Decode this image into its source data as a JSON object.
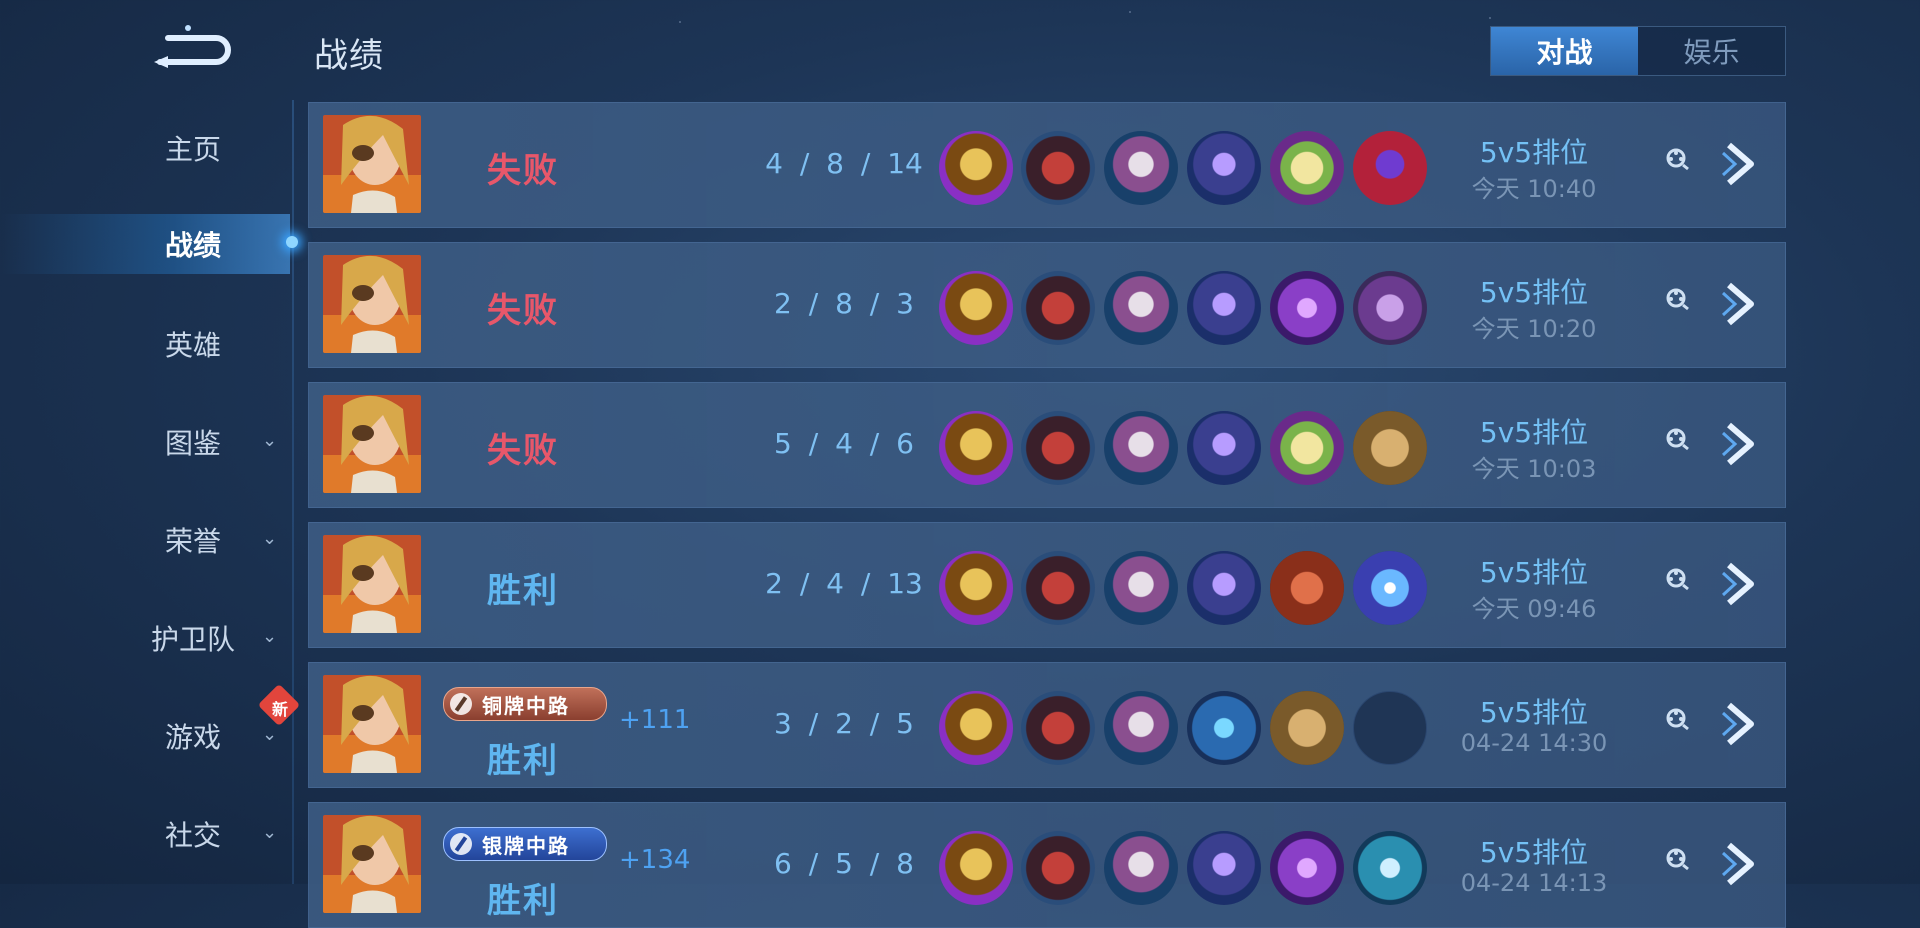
{
  "header": {
    "title": "战绩",
    "mode_tabs": [
      {
        "label": "对战",
        "active": true
      },
      {
        "label": "娱乐",
        "active": false
      }
    ]
  },
  "sidebar": {
    "items": [
      {
        "label": "主页",
        "has_chevron": false,
        "active": false
      },
      {
        "label": "战绩",
        "has_chevron": false,
        "active": true
      },
      {
        "label": "英雄",
        "has_chevron": false,
        "active": false
      },
      {
        "label": "图鉴",
        "has_chevron": true,
        "active": false
      },
      {
        "label": "荣誉",
        "has_chevron": true,
        "active": false
      },
      {
        "label": "护卫队",
        "has_chevron": true,
        "active": false
      },
      {
        "label": "游戏",
        "has_chevron": true,
        "active": false
      },
      {
        "label": "社交",
        "has_chevron": true,
        "active": false
      }
    ],
    "new_badge": "新"
  },
  "matches": [
    {
      "result": "失败",
      "outcome": "lose",
      "rank_badge": "",
      "rank_tier": "",
      "score_delta": "",
      "kda": "4 / 8 / 14",
      "mode": "5v5排位",
      "time": "今天 10:40",
      "items": [
        "gold-helmet-icon",
        "red-armor-icon",
        "skull-mask-icon",
        "purple-mace-icon",
        "spellbook-icon",
        "red-cloak-icon"
      ]
    },
    {
      "result": "失败",
      "outcome": "lose",
      "rank_badge": "",
      "rank_tier": "",
      "score_delta": "",
      "kda": "2 / 8 / 3",
      "mode": "5v5排位",
      "time": "今天 10:20",
      "items": [
        "gold-helmet-icon",
        "red-armor-icon",
        "skull-mask-icon",
        "purple-mace-icon",
        "purple-scepter-icon",
        "purple-tome-icon"
      ]
    },
    {
      "result": "失败",
      "outcome": "lose",
      "rank_badge": "",
      "rank_tier": "",
      "score_delta": "",
      "kda": "5 / 4 / 6",
      "mode": "5v5排位",
      "time": "今天 10:03",
      "items": [
        "gold-helmet-icon",
        "red-armor-icon",
        "skull-mask-icon",
        "purple-mace-icon",
        "spellbook-icon",
        "wooden-shield-icon"
      ]
    },
    {
      "result": "胜利",
      "outcome": "win",
      "rank_badge": "",
      "rank_tier": "",
      "score_delta": "",
      "kda": "2 / 4 / 13",
      "mode": "5v5排位",
      "time": "今天 09:46",
      "items": [
        "gold-helmet-icon",
        "red-armor-icon",
        "skull-mask-icon",
        "purple-mace-icon",
        "red-book-icon",
        "blue-orb-icon"
      ]
    },
    {
      "result": "胜利",
      "outcome": "win",
      "rank_badge": "铜牌中路",
      "rank_tier": "bronze",
      "score_delta": "+111",
      "kda": "3 / 2 / 5",
      "mode": "5v5排位",
      "time": "04-24  14:30",
      "items": [
        "gold-helmet-icon",
        "red-armor-icon",
        "skull-mask-icon",
        "blue-staff-icon",
        "wooden-shield-icon",
        "empty-slot"
      ]
    },
    {
      "result": "胜利",
      "outcome": "win",
      "rank_badge": "银牌中路",
      "rank_tier": "silver",
      "score_delta": "+134",
      "kda": "6 / 5 / 8",
      "mode": "5v5排位",
      "time": "04-24  14:13",
      "items": [
        "gold-helmet-icon",
        "red-armor-icon",
        "skull-mask-icon",
        "purple-mace-icon",
        "purple-scepter-icon",
        "cyan-rune-icon"
      ]
    }
  ],
  "colors": {
    "lose": "#e8576a",
    "win": "#5fb6f0",
    "accent": "#3f86d4"
  }
}
